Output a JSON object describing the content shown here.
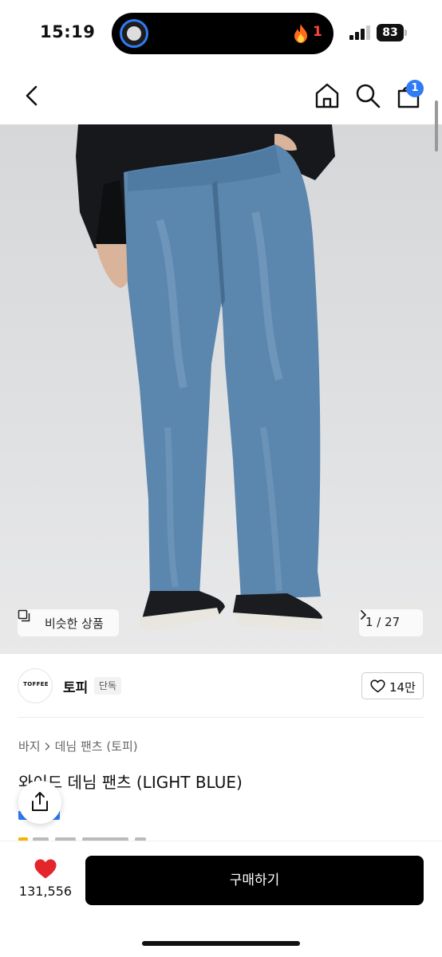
{
  "status_bar": {
    "time": "15:19",
    "activity_count": "1",
    "battery": "83"
  },
  "nav": {
    "back_icon": "chevron-left-icon",
    "home_icon": "home-icon",
    "search_icon": "search-icon",
    "cart_icon": "shopping-bag-icon",
    "cart_badge": "1"
  },
  "gallery": {
    "similar_label": "비슷한 상품",
    "page_indicator": "1 / 27"
  },
  "brand": {
    "logo_text": "TOFFEE",
    "name": "토피",
    "badge": "단독",
    "like_count": "14만"
  },
  "product": {
    "breadcrumb": [
      "바지",
      "데님 팬츠 (토피)"
    ],
    "title": "와이드 데님 팬츠 (LIGHT BLUE)"
  },
  "bottom_bar": {
    "wish_count": "131,556",
    "buy_label": "구매하기"
  },
  "colors": {
    "accent_blue": "#2f7cf6",
    "heart_red": "#e4262c",
    "buy_button": "#000000"
  }
}
